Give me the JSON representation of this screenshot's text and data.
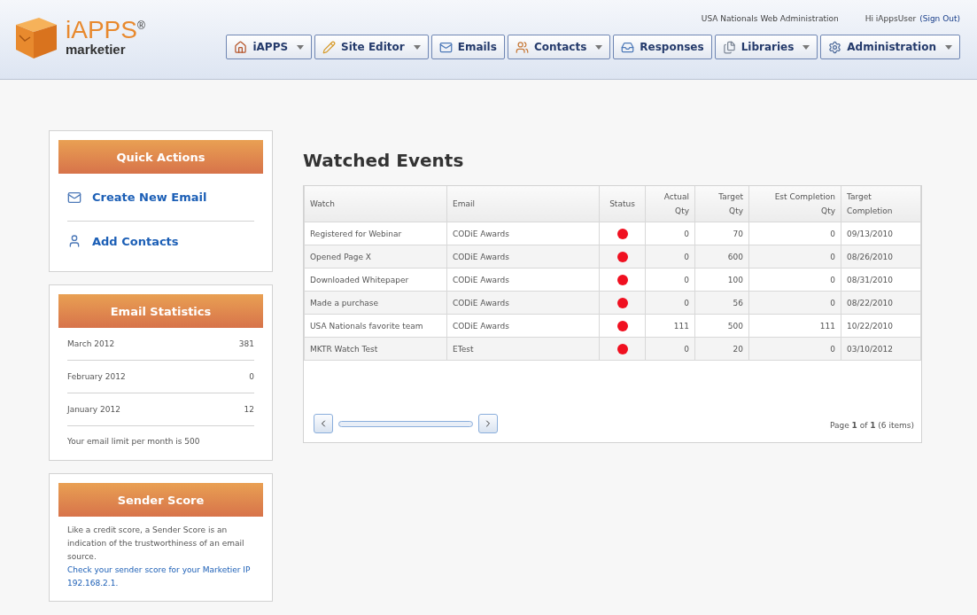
{
  "header": {
    "logo": {
      "brand": "iAPPS",
      "registered": "®",
      "product": "marketier"
    },
    "site_name": "USA Nationals Web Administration",
    "greeting": "Hi iAppsUser",
    "sign_out": "(Sign Out)",
    "nav": [
      {
        "label": "iAPPS",
        "dropdown": true
      },
      {
        "label": "Site Editor",
        "dropdown": true
      },
      {
        "label": "Emails",
        "dropdown": false
      },
      {
        "label": "Contacts",
        "dropdown": true
      },
      {
        "label": "Responses",
        "dropdown": false
      },
      {
        "label": "Libraries",
        "dropdown": true
      },
      {
        "label": "Administration",
        "dropdown": true
      }
    ]
  },
  "quick_actions": {
    "title": "Quick Actions",
    "items": [
      "Create New Email",
      "Add Contacts"
    ]
  },
  "email_statistics": {
    "title": "Email Statistics",
    "rows": [
      {
        "month": "March 2012",
        "count": "381"
      },
      {
        "month": "February 2012",
        "count": "0"
      },
      {
        "month": "January 2012",
        "count": "12"
      }
    ],
    "note": "Your email limit per month is 500"
  },
  "sender_score": {
    "title": "Sender Score",
    "text": "Like a credit score, a Sender Score is an indication of the trustworthiness of an email source.",
    "link": "Check your sender score for your Marketier IP 192.168.2.1."
  },
  "watched_events": {
    "title": "Watched Events",
    "columns": [
      "Watch",
      "Email",
      "Status",
      "Actual Qty",
      "Target Qty",
      "Est Completion Qty",
      "Target Completion"
    ],
    "rows": [
      {
        "cells": [
          "Registered for Webinar",
          "CODiE Awards",
          "",
          "0",
          "70",
          "0",
          "09/13/2010"
        ],
        "color": "#f01020"
      },
      {
        "cells": [
          "Opened Page X",
          "CODiE Awards",
          "",
          "0",
          "600",
          "0",
          "08/26/2010"
        ],
        "color": "#f01020"
      },
      {
        "cells": [
          "Downloaded Whitepaper",
          "CODiE Awards",
          "",
          "0",
          "100",
          "0",
          "08/31/2010"
        ],
        "color": "#f01020"
      },
      {
        "cells": [
          "Made a purchase",
          "CODiE Awards",
          "",
          "0",
          "56",
          "0",
          "08/22/2010"
        ],
        "color": "#f01020"
      },
      {
        "cells": [
          "USA Nationals favorite team",
          "CODiE Awards",
          "",
          "111",
          "500",
          "111",
          "10/22/2010"
        ],
        "color": "#f01020"
      },
      {
        "cells": [
          "MKTR Watch Test",
          "ETest",
          "",
          "0",
          "20",
          "0",
          "03/10/2012"
        ],
        "color": "#f01020"
      }
    ],
    "pager": "Page **1** of **1** (6 items)"
  }
}
